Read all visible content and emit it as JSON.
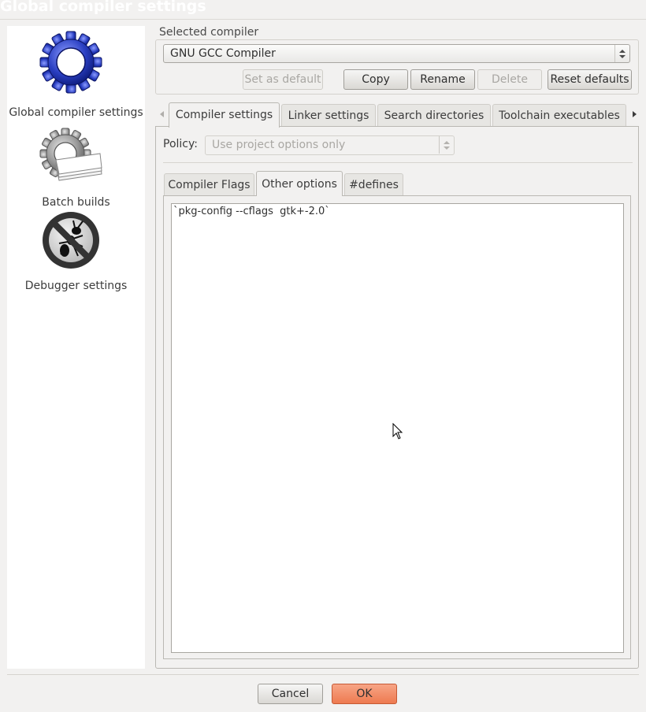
{
  "window": {
    "title": "Global compiler settings"
  },
  "sidebar": {
    "items": [
      {
        "label": "Global compiler settings",
        "icon": "gear-icon"
      },
      {
        "label": "Batch builds",
        "icon": "batch-gear-icon"
      },
      {
        "label": "Debugger settings",
        "icon": "no-bug-icon"
      }
    ]
  },
  "compiler": {
    "group_label": "Selected compiler",
    "selected": "GNU GCC Compiler",
    "buttons": {
      "set_default": "Set as default",
      "copy": "Copy",
      "rename": "Rename",
      "delete": "Delete",
      "reset": "Reset defaults"
    }
  },
  "tabs": {
    "top": [
      "Compiler settings",
      "Linker settings",
      "Search directories",
      "Toolchain executables"
    ],
    "inner": [
      "Compiler Flags",
      "Other options",
      "#defines"
    ]
  },
  "policy": {
    "label": "Policy:",
    "value": "Use project options only"
  },
  "other_options": {
    "text": "`pkg-config --cflags  gtk+-2.0`"
  },
  "footer": {
    "cancel": "Cancel",
    "ok": "OK"
  },
  "colors": {
    "accent_ok": "#ee7a50",
    "gear_blue": "#2a3fc2"
  }
}
